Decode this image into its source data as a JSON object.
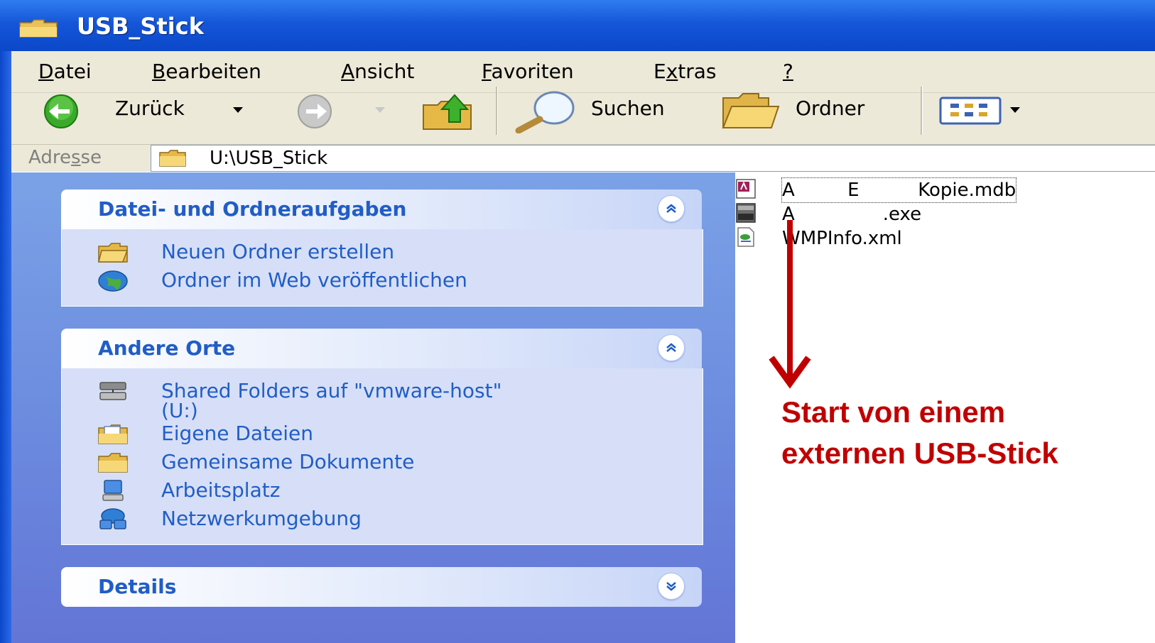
{
  "window": {
    "title": "USB_Stick",
    "title_icon": "folder-icon"
  },
  "menu": [
    {
      "mnemonic": "D",
      "rest": "atei"
    },
    {
      "mnemonic": "B",
      "rest": "earbeiten"
    },
    {
      "mnemonic": "A",
      "rest": "nsicht"
    },
    {
      "mnemonic": "F",
      "rest": "avoriten"
    },
    {
      "pre": "E",
      "mnemonic": "x",
      "rest": "tras"
    },
    {
      "mnemonic": "?",
      "rest": ""
    }
  ],
  "toolbar": {
    "back_label": "Zurück",
    "search_label": "Suchen",
    "folders_label": "Ordner"
  },
  "address": {
    "label_pre": "Adre",
    "label_mnemonic": "s",
    "label_post": "se",
    "value": "U:\\USB_Stick"
  },
  "task_panels": [
    {
      "title": "Datei- und Ordneraufgaben",
      "collapse_icon": "chevron-up-icon",
      "items": [
        {
          "label": "Neuen Ordner erstellen",
          "icon": "new-folder-icon"
        },
        {
          "label": "Ordner im Web veröffentlichen",
          "icon": "web-publish-icon"
        }
      ]
    },
    {
      "title": "Andere Orte",
      "collapse_icon": "chevron-up-icon",
      "items": [
        {
          "label": "Shared Folders auf \"vmware-host\"",
          "label2": "(U:)",
          "icon": "network-drive-icon"
        },
        {
          "label": "Eigene Dateien",
          "icon": "my-documents-icon"
        },
        {
          "label": "Gemeinsame Dokumente",
          "icon": "shared-documents-icon"
        },
        {
          "label": "Arbeitsplatz",
          "icon": "my-computer-icon"
        },
        {
          "label": "Netzwerkumgebung",
          "icon": "network-places-icon"
        }
      ]
    },
    {
      "title": "Details",
      "collapse_icon": "chevron-down-icon"
    }
  ],
  "files": [
    {
      "name": "A         E          Kopie.mdb",
      "icon": "access-db-icon",
      "selected": true
    },
    {
      "name": "A               .exe",
      "icon": "exe-icon",
      "selected": false
    },
    {
      "name": "WMPInfo.xml",
      "icon": "xml-file-icon",
      "selected": false
    }
  ],
  "annotation": {
    "line1": "Start von einem",
    "line2": "externen USB-Stick",
    "color": "#c00000"
  },
  "colors": {
    "titlebar": "#1556d8",
    "taskpane": "#6f8fe0",
    "panel_link": "#215dc6",
    "chrome": "#ece9d8"
  }
}
